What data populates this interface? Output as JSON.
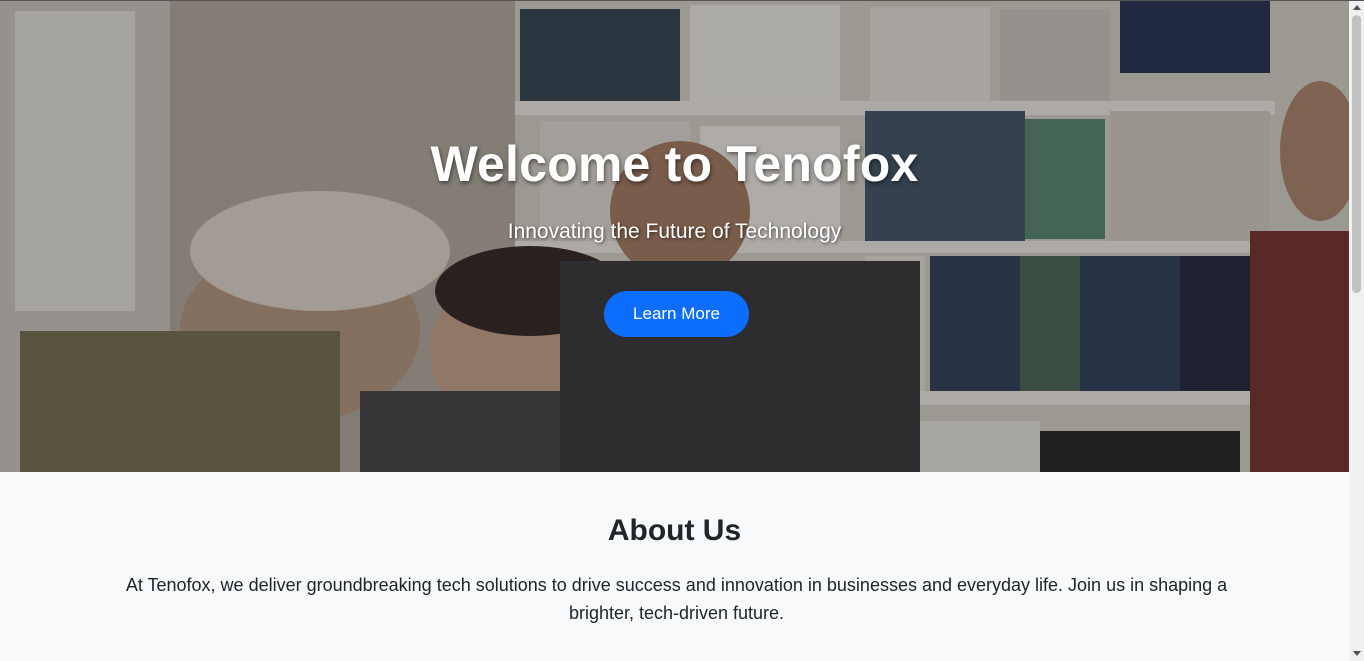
{
  "hero": {
    "title": "Welcome to Tenofox",
    "subtitle": "Innovating the Future of Technology",
    "cta_label": "Learn More",
    "background": "photo of people laughing in front of bookshelves"
  },
  "about": {
    "title": "About Us",
    "text": "At Tenofox, we deliver groundbreaking tech solutions to drive success and innovation in businesses and everyday life. Join us in shaping a brighter, tech-driven future."
  },
  "colors": {
    "accent": "#0d6efd",
    "section_bg": "#f8f9fa",
    "text": "#212529"
  },
  "icons": {
    "scroll_up": "chevron-up-icon",
    "scroll_down": "chevron-down-icon"
  }
}
